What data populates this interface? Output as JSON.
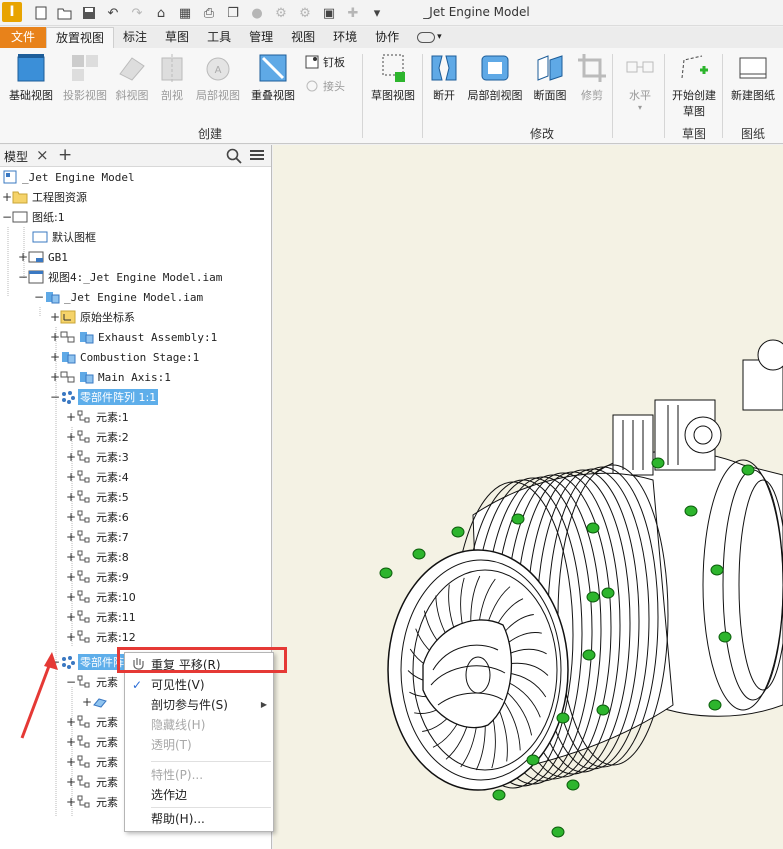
{
  "app": {
    "logo_letter": "I",
    "window_title": "_Jet Engine Model"
  },
  "menu_tabs": [
    "文件",
    "放置视图",
    "标注",
    "草图",
    "工具",
    "管理",
    "视图",
    "环境",
    "协作"
  ],
  "ribbon": {
    "buttons": {
      "base_view": "基础视图",
      "projected_view": "投影视图",
      "auxiliary_view": "斜视图",
      "section_view": "剖视",
      "detail_view": "局部视图",
      "overlay_view": "重叠视图",
      "nail": "钉板",
      "connect": "接头",
      "sketch_view": "草图视图",
      "break": "断开",
      "break_out": "局部剖视图",
      "slice": "断面图",
      "crop": "修剪",
      "horizontal": "水平",
      "start_sketch_1": "开始创建",
      "start_sketch_2": "草图",
      "new_sheet": "新建图纸"
    },
    "groups": {
      "create": "创建",
      "modify": "修改",
      "sketch": "草图",
      "sheet": "图纸"
    }
  },
  "browser": {
    "tab_label": "模型",
    "tree": [
      {
        "label": "_Jet Engine Model"
      },
      {
        "label": "工程图资源"
      },
      {
        "label": "图纸:1"
      },
      {
        "label": "默认图框"
      },
      {
        "label": "GB1"
      },
      {
        "label": "视图4:_Jet Engine Model.iam"
      },
      {
        "label": "_Jet Engine Model.iam"
      },
      {
        "label": "原始坐标系"
      },
      {
        "label": "Exhaust Assembly:1"
      },
      {
        "label": "Combustion Stage:1"
      },
      {
        "label": "Main Axis:1"
      },
      {
        "label": "零部件阵列 1:1"
      },
      {
        "label": "元素:1"
      },
      {
        "label": "元素:2"
      },
      {
        "label": "元素:3"
      },
      {
        "label": "元素:4"
      },
      {
        "label": "元素:5"
      },
      {
        "label": "元素:6"
      },
      {
        "label": "元素:7"
      },
      {
        "label": "元素:8"
      },
      {
        "label": "元素:9"
      },
      {
        "label": "元素:10"
      },
      {
        "label": "元素:11"
      },
      {
        "label": "元素:12"
      },
      {
        "label": "零部件阵列"
      },
      {
        "label": "元素"
      },
      {
        "label": ""
      },
      {
        "label": "元素"
      },
      {
        "label": "元素"
      },
      {
        "label": "元素"
      },
      {
        "label": "元素"
      },
      {
        "label": "元素"
      }
    ]
  },
  "context_menu": {
    "items": [
      {
        "label": "重复 平移(R)"
      },
      {
        "label": "可见性(V)"
      },
      {
        "label": "剖切参与件(S)"
      },
      {
        "label": "隐藏线(H)"
      },
      {
        "label": "透明(T)"
      },
      {
        "label": "特性(P)..."
      },
      {
        "label": "选作边"
      },
      {
        "label": "帮助(H)..."
      }
    ]
  },
  "colors": {
    "file_tab": "#e8821a",
    "selection": "#5eaeea",
    "highlight_box": "#e53935",
    "annotation_arrow": "#e53935",
    "canvas_bg": "#f4f2e4",
    "bolt_green": "#2db52d"
  }
}
